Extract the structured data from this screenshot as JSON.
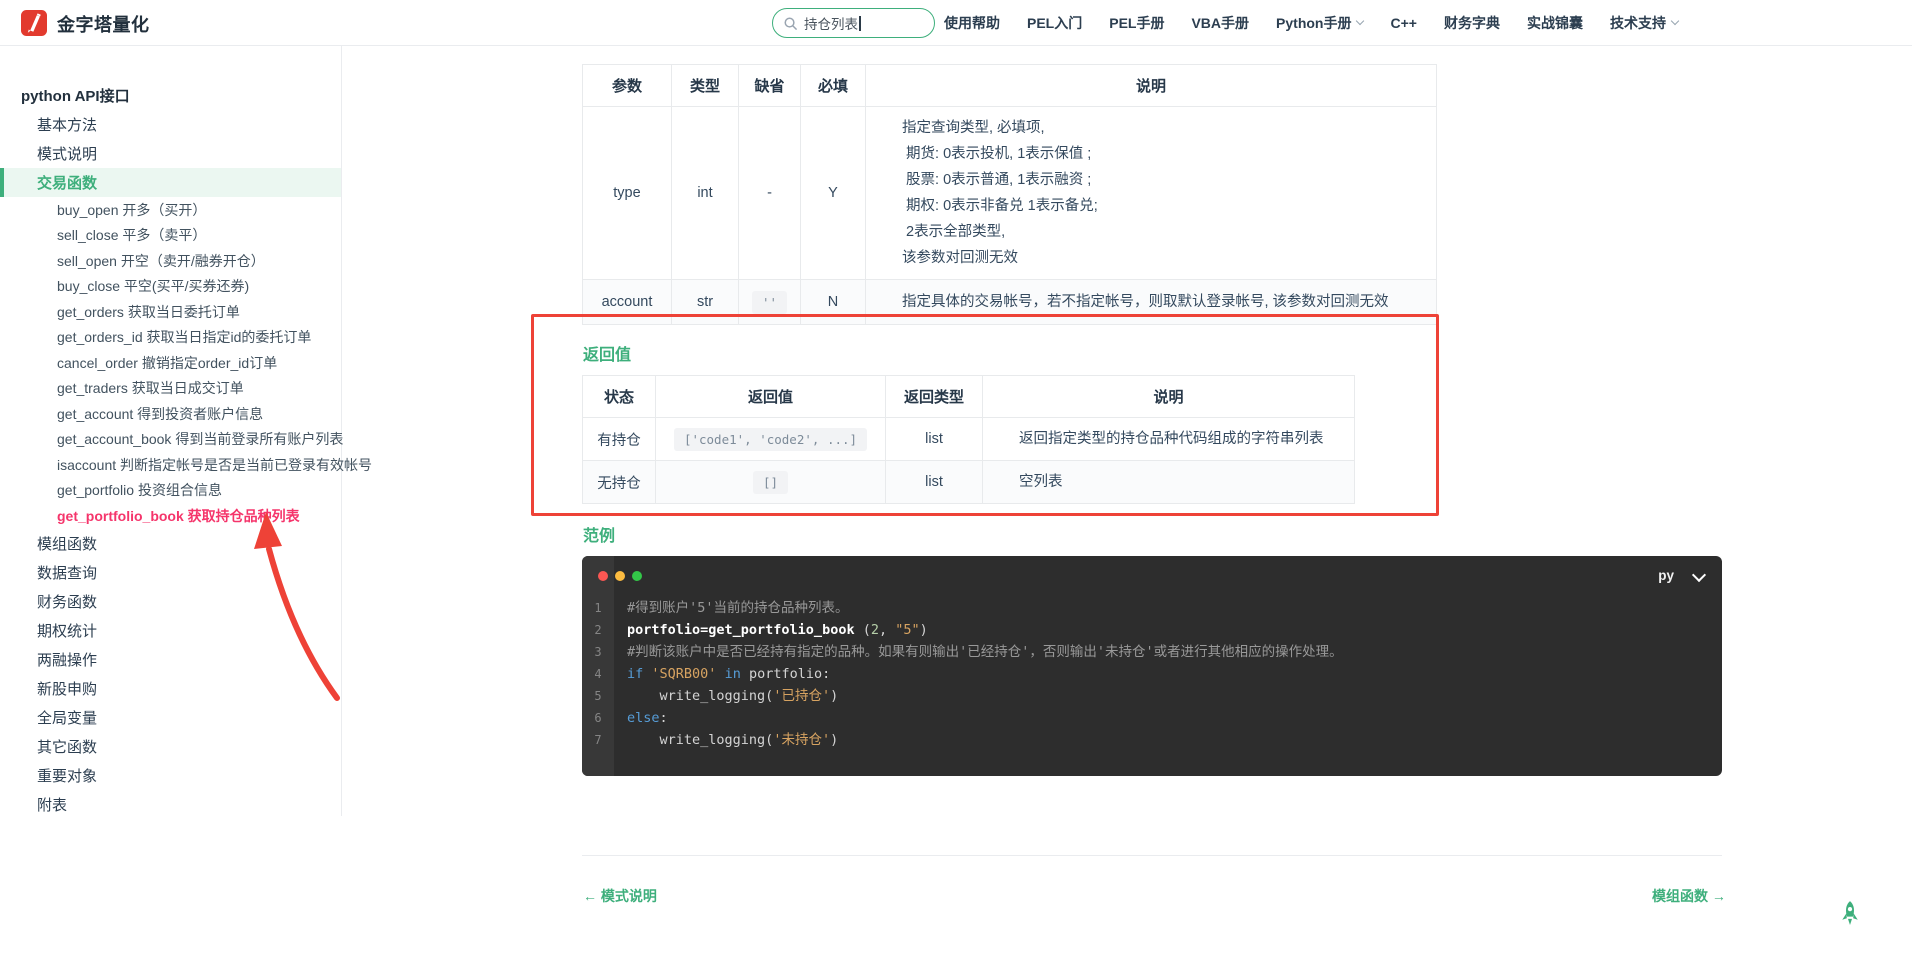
{
  "colors": {
    "accent_green": "#3eaf7c",
    "annotation_red": "#ee4237",
    "active_pink": "#f5356b",
    "code_bg": "#2d2d2d"
  },
  "header": {
    "title": "金字塔量化",
    "search": {
      "value": "持仓列表"
    },
    "nav": [
      {
        "label": "使用帮助",
        "dropdown": false
      },
      {
        "label": "PEL入门",
        "dropdown": false
      },
      {
        "label": "PEL手册",
        "dropdown": false
      },
      {
        "label": "VBA手册",
        "dropdown": false
      },
      {
        "label": "Python手册",
        "dropdown": true
      },
      {
        "label": "C++",
        "dropdown": false
      },
      {
        "label": "财务字典",
        "dropdown": false
      },
      {
        "label": "实战锦囊",
        "dropdown": false
      },
      {
        "label": "技术支持",
        "dropdown": true
      }
    ]
  },
  "sidebar": {
    "items": [
      {
        "label": "python API接口",
        "level": 0,
        "state": ""
      },
      {
        "label": "基本方法",
        "level": 1,
        "state": ""
      },
      {
        "label": "模式说明",
        "level": 1,
        "state": ""
      },
      {
        "label": "交易函数",
        "level": 1,
        "state": "active-green"
      },
      {
        "label": "buy_open 开多（买开）",
        "level": 2,
        "state": ""
      },
      {
        "label": "sell_close 平多（卖平）",
        "level": 2,
        "state": ""
      },
      {
        "label": "sell_open 开空（卖开/融券开仓）",
        "level": 2,
        "state": ""
      },
      {
        "label": "buy_close 平空(买平/买券还券)",
        "level": 2,
        "state": ""
      },
      {
        "label": "get_orders 获取当日委托订单",
        "level": 2,
        "state": ""
      },
      {
        "label": "get_orders_id 获取当日指定id的委托订单",
        "level": 2,
        "state": ""
      },
      {
        "label": "cancel_order 撤销指定order_id订单",
        "level": 2,
        "state": ""
      },
      {
        "label": "get_traders 获取当日成交订单",
        "level": 2,
        "state": ""
      },
      {
        "label": "get_account 得到投资者账户信息",
        "level": 2,
        "state": ""
      },
      {
        "label": "get_account_book 得到当前登录所有账户列表",
        "level": 2,
        "state": ""
      },
      {
        "label": "isaccount 判断指定帐号是否是当前已登录有效帐号",
        "level": 2,
        "state": ""
      },
      {
        "label": "get_portfolio 投资组合信息",
        "level": 2,
        "state": ""
      },
      {
        "label": "get_portfolio_book 获取持仓品种列表",
        "level": 2,
        "state": "active-red"
      },
      {
        "label": "模组函数",
        "level": 1,
        "state": ""
      },
      {
        "label": "数据查询",
        "level": 1,
        "state": ""
      },
      {
        "label": "财务函数",
        "level": 1,
        "state": ""
      },
      {
        "label": "期权统计",
        "level": 1,
        "state": ""
      },
      {
        "label": "两融操作",
        "level": 1,
        "state": ""
      },
      {
        "label": "新股申购",
        "level": 1,
        "state": ""
      },
      {
        "label": "全局变量",
        "level": 1,
        "state": ""
      },
      {
        "label": "其它函数",
        "level": 1,
        "state": ""
      },
      {
        "label": "重要对象",
        "level": 1,
        "state": ""
      },
      {
        "label": "附表",
        "level": 1,
        "state": ""
      }
    ]
  },
  "params_table": {
    "headers": [
      "参数",
      "类型",
      "缺省",
      "必填",
      "说明"
    ],
    "rows": [
      {
        "param": "type",
        "type": "int",
        "default": "-",
        "default_chip": false,
        "required": "Y",
        "desc": "指定查询类型, 必填项,\n 期货: 0表示投机, 1表示保值 ;\n 股票: 0表示普通, 1表示融资 ;\n 期权: 0表示非备兑 1表示备兑;\n 2表示全部类型,\n该参数对回测无效",
        "striped": false
      },
      {
        "param": "account",
        "type": "str",
        "default": "''",
        "default_chip": true,
        "required": "N",
        "desc": "指定具体的交易帐号，若不指定帐号，则取默认登录帐号, 该参数对回测无效",
        "striped": true
      }
    ]
  },
  "returns": {
    "heading": "返回值",
    "headers": [
      "状态",
      "返回值",
      "返回类型",
      "说明"
    ],
    "rows": [
      {
        "status": "有持仓",
        "value": "['code1', 'code2', ...]",
        "rtype": "list",
        "desc": "返回指定类型的持仓品种代码组成的字符串列表",
        "striped": false
      },
      {
        "status": "无持仓",
        "value": "[]",
        "rtype": "list",
        "desc": "空列表",
        "striped": true
      }
    ]
  },
  "example": {
    "heading": "范例",
    "lang": "py",
    "lines": [
      [
        [
          "c",
          "#得到账户'5'当前的持仓品种列表。"
        ]
      ],
      [
        [
          "b",
          "portfolio=get_portfolio_book"
        ],
        [
          "p",
          " ("
        ],
        [
          "n",
          "2"
        ],
        [
          "p",
          ", "
        ],
        [
          "s",
          "\"5\""
        ],
        [
          "p",
          ")"
        ]
      ],
      [
        [
          "c",
          "#判断该账户中是否已经持有指定的品种。如果有则输出'已经持仓'，否则输出'未持仓'或者进行其他相应的操作处理。"
        ]
      ],
      [
        [
          "k",
          "if"
        ],
        [
          "p",
          " "
        ],
        [
          "s",
          "'SQRB00'"
        ],
        [
          "p",
          " "
        ],
        [
          "k",
          "in"
        ],
        [
          "p",
          " portfolio:"
        ]
      ],
      [
        [
          "p",
          "    write_logging("
        ],
        [
          "s",
          "'已持仓'"
        ],
        [
          "p",
          ")"
        ]
      ],
      [
        [
          "k",
          "else"
        ],
        [
          "p",
          ":"
        ]
      ],
      [
        [
          "p",
          "    write_logging("
        ],
        [
          "s",
          "'未持仓'"
        ],
        [
          "p",
          ")"
        ]
      ]
    ]
  },
  "footer": {
    "prev": "← 模式说明",
    "next": "模组函数 →"
  }
}
